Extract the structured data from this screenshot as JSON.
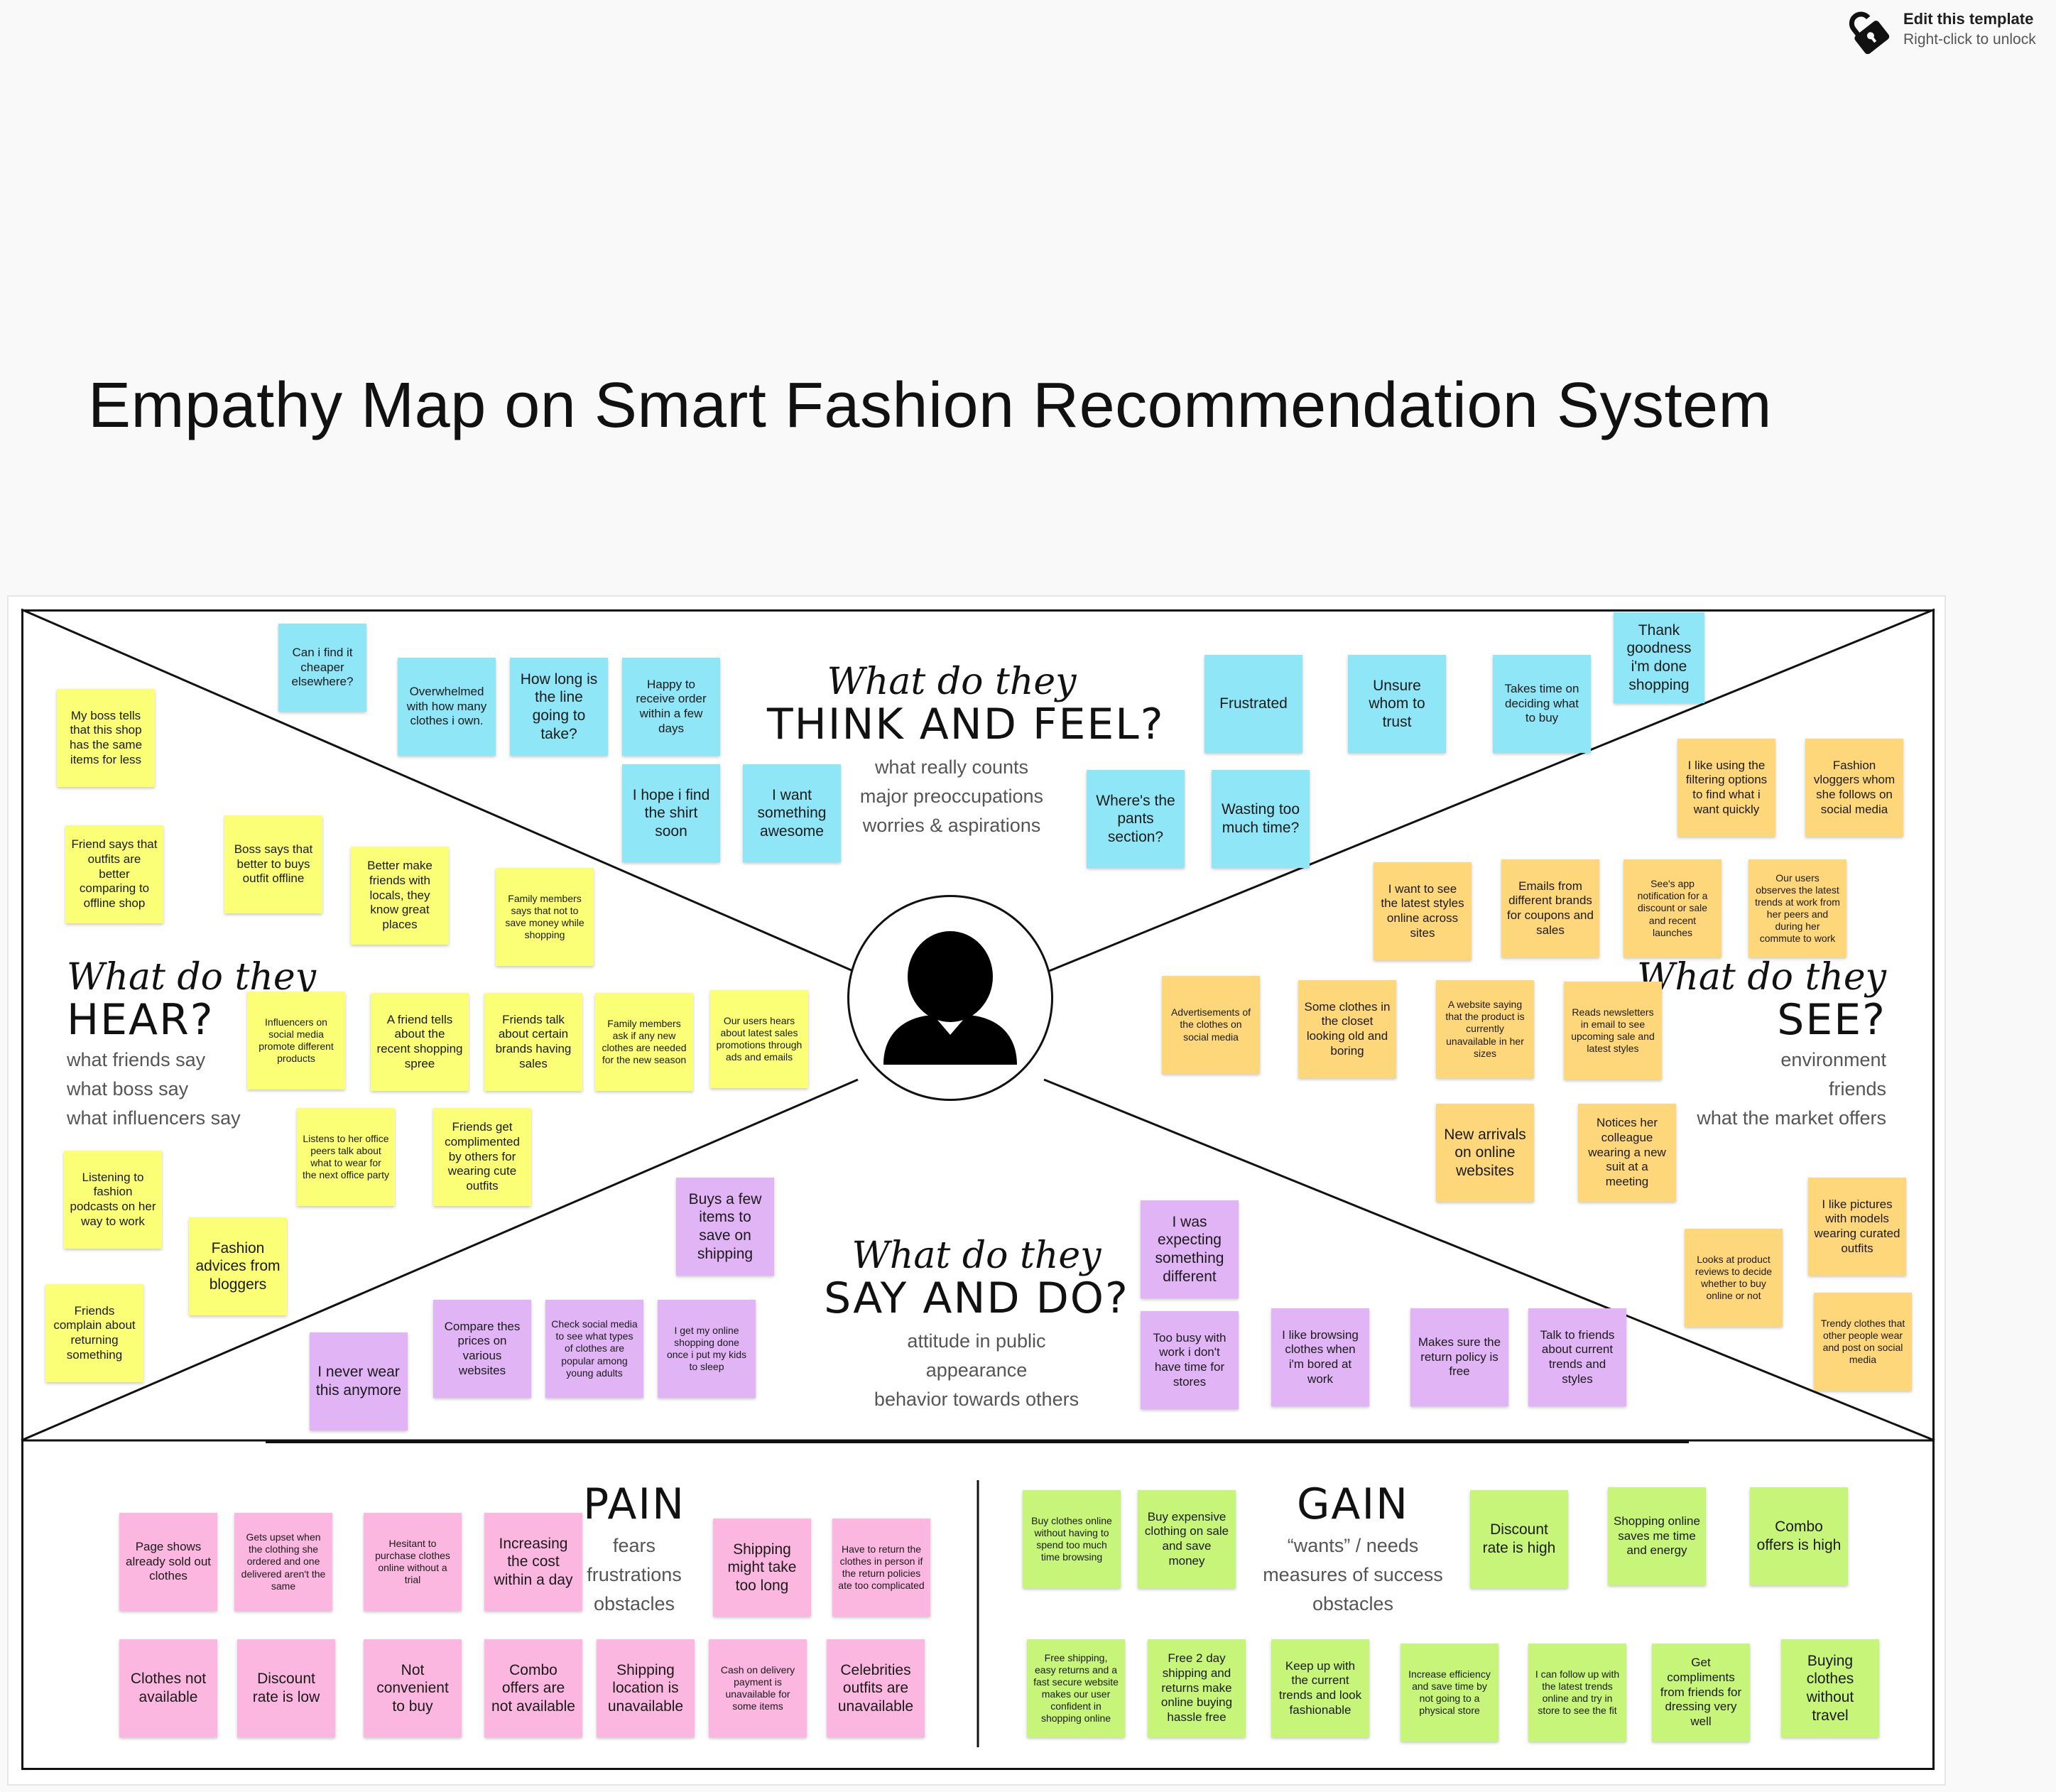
{
  "lock": {
    "title": "Edit this template",
    "subtitle": "Right-click to unlock"
  },
  "page_title": "Empathy Map on Smart Fashion Recommendation System",
  "quadrants": {
    "think": {
      "script": "What do they",
      "title": "THINK AND FEEL?",
      "lines": [
        "what really counts",
        "major preoccupations",
        "worries & aspirations"
      ]
    },
    "hear": {
      "script": "What do they",
      "title": "HEAR?",
      "lines": [
        "what friends say",
        "what boss say",
        "what influencers say"
      ]
    },
    "see": {
      "script": "What do they",
      "title": "SEE?",
      "lines": [
        "environment",
        "friends",
        "what the market offers"
      ]
    },
    "say": {
      "script": "What do they",
      "title": "SAY AND DO?",
      "lines": [
        "attitude in public",
        "appearance",
        "behavior towards others"
      ]
    },
    "pain": {
      "title": "PAIN",
      "lines": [
        "fears",
        "frustrations",
        "obstacles"
      ]
    },
    "gain": {
      "title": "GAIN",
      "lines": [
        "“wants” / needs",
        "measures of success",
        "obstacles"
      ]
    }
  },
  "notes": {
    "think": [
      "Can i find it cheaper elsewhere?",
      "Overwhelmed with how many clothes i own.",
      "How long is the line going to take?",
      "Happy to receive order within a few days",
      "I hope i find the shirt soon",
      "I want something awesome",
      "Frustrated",
      "Unsure whom to trust",
      "Takes time on deciding what to buy",
      "Thank goodness i'm done shopping",
      "Where's the pants section?",
      "Wasting too much time?"
    ],
    "hear": [
      "My boss tells that this shop has the same items for less",
      "Friend says that outfits are better comparing to offline shop",
      "Boss says that better to buys outfit offline",
      "Better make friends with locals, they know great places",
      "Family members says that not to save money while shopping",
      "Influencers on social media promote different products",
      "A friend tells about the recent shopping spree",
      "Friends talk about certain brands having sales",
      "Family members ask if any new clothes are needed for the new season",
      "Our users hears about latest sales promotions through ads and emails",
      "Listens to her office peers talk about what to wear for the next office party",
      "Friends get complimented by others for wearing cute outfits",
      "Listening to fashion podcasts on her way to work",
      "Fashion advices from bloggers",
      "Friends complain about returning something"
    ],
    "see": [
      "I like using the filtering options to find what i want quickly",
      "Fashion vloggers whom she follows on social media",
      "I want to see the latest styles online across sites",
      "Emails from different brands for coupons and sales",
      "See's app notification for a discount or sale and recent launches",
      "Our users observes the latest trends at work from her peers and during her commute to work",
      "Advertisements of the clothes on social media",
      "Some clothes in the closet looking old and boring",
      "A website saying that the product is currently unavailable in her sizes",
      "Reads newsletters in email to see upcoming sale and latest styles",
      "New arrivals on online websites",
      "Notices her colleague wearing a new suit at a meeting",
      "I like pictures with models wearing curated outfits",
      "Looks at product reviews to decide whether to buy online or not",
      "Trendy clothes that other people wear and post on social media"
    ],
    "say": [
      "Buys a few items to save on shipping",
      "I was expecting something different",
      "Compare thes prices on various websites",
      "Check social media to see what types of clothes are popular among young adults",
      "I get my online shopping done once i put my kids to sleep",
      "I never wear this anymore",
      "Too busy with work i don't have time for stores",
      "I like browsing clothes when i'm bored at work",
      "Makes sure the return policy is free",
      "Talk to friends about current trends and styles"
    ],
    "pain": [
      "Page shows already sold out clothes",
      "Gets upset when the clothing she ordered and one delivered aren't the same",
      "Hesitant to purchase clothes online without a trial",
      "Increasing the cost within a day",
      "Shipping might take too long",
      "Have to return the clothes in person if the return policies ate too complicated",
      "Clothes not available",
      "Discount rate is low",
      "Not convenient to buy",
      "Combo offers are not available",
      "Shipping location is unavailable",
      "Cash on delivery payment is unavailable for some items",
      "Celebrities outfits are unavailable"
    ],
    "gain": [
      "Buy clothes online without having to spend too much time browsing",
      "Buy expensive clothing on sale and save money",
      "Discount rate is high",
      "Shopping online saves me time and energy",
      "Combo offers is high",
      "Free shipping, easy returns and a fast secure website makes our user confident in shopping online",
      "Free 2 day shipping and returns make online buying hassle free",
      "Keep up with the current trends and look fashionable",
      "Increase efficiency and save time by not going to a physical store",
      "I can follow up with the latest trends online and try in store to see the fit",
      "Get compliments from friends for dressing very well",
      "Buying clothes without travel"
    ]
  },
  "colors": {
    "hear": "#faff75",
    "think": "#8ee6f7",
    "see": "#ffd77b",
    "say": "#e1b5f5",
    "pain": "#fbb7e0",
    "gain": "#c7f57a"
  },
  "icons": {
    "lock": "lock-icon",
    "user": "user-silhouette-icon"
  }
}
